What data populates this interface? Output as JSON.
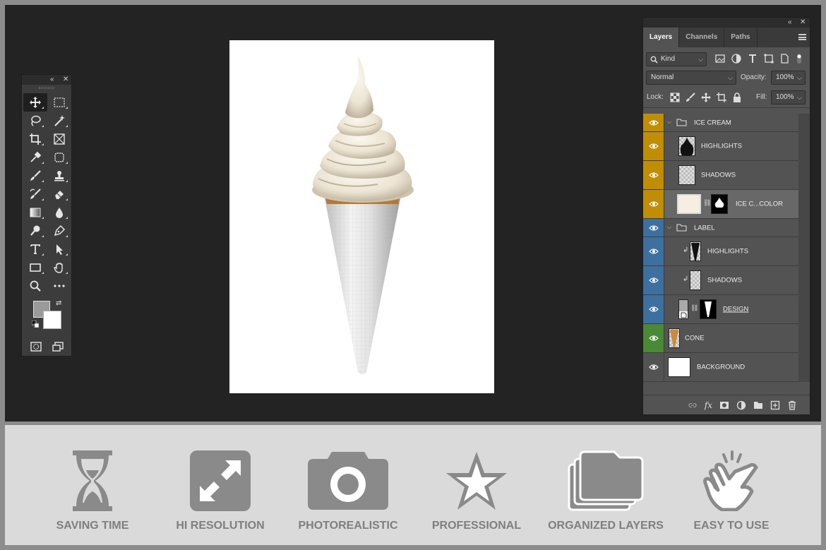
{
  "tools_panel": {
    "collapse_icon": "double-chevron-left-icon",
    "close_icon": "close-icon",
    "tools": [
      {
        "name": "move-tool",
        "icon": "move-icon",
        "active": true
      },
      {
        "name": "marquee-tool",
        "icon": "rect-marquee-icon"
      },
      {
        "name": "lasso-tool",
        "icon": "lasso-icon"
      },
      {
        "name": "magic-wand-tool",
        "icon": "magic-wand-icon"
      },
      {
        "name": "crop-tool",
        "icon": "crop-icon"
      },
      {
        "name": "frame-tool",
        "icon": "frame-icon"
      },
      {
        "name": "eyedropper-tool",
        "icon": "eyedropper-icon"
      },
      {
        "name": "spot-heal-tool",
        "icon": "patch-icon"
      },
      {
        "name": "brush-tool",
        "icon": "brush-icon"
      },
      {
        "name": "stamp-tool",
        "icon": "stamp-icon"
      },
      {
        "name": "history-brush-tool",
        "icon": "history-brush-icon"
      },
      {
        "name": "eraser-tool",
        "icon": "eraser-icon"
      },
      {
        "name": "gradient-tool",
        "icon": "gradient-icon"
      },
      {
        "name": "blur-tool",
        "icon": "drop-icon"
      },
      {
        "name": "dodge-tool",
        "icon": "dodge-icon"
      },
      {
        "name": "pen-tool",
        "icon": "pen-icon"
      },
      {
        "name": "type-tool",
        "icon": "type-icon"
      },
      {
        "name": "path-select-tool",
        "icon": "arrow-icon"
      },
      {
        "name": "shape-tool",
        "icon": "rectangle-icon"
      },
      {
        "name": "hand-tool",
        "icon": "hand-icon"
      },
      {
        "name": "zoom-tool",
        "icon": "zoom-icon"
      },
      {
        "name": "more-tool",
        "icon": "more-icon"
      }
    ],
    "foreground_color": "#9a9a9a",
    "background_color": "#ffffff"
  },
  "layers_panel": {
    "tabs": [
      "Layers",
      "Channels",
      "Paths"
    ],
    "active_tab": "Layers",
    "filter": {
      "value": "Kind"
    },
    "blend_mode": {
      "value": "Normal"
    },
    "opacity": {
      "label": "Opacity:",
      "value": "100%"
    },
    "lock": {
      "label": "Lock:"
    },
    "fill": {
      "label": "Fill:",
      "value": "100%"
    },
    "layers": [
      {
        "name": "ICE CREAM",
        "kind": "group",
        "color": "#c08e06"
      },
      {
        "name": "HIGHLIGHTS",
        "kind": "layer",
        "color": "#c08e06",
        "thumb": "highlights"
      },
      {
        "name": "SHADOWS",
        "kind": "layer",
        "color": "#c08e06",
        "thumb": "checker"
      },
      {
        "name": "ICE C...COLOR",
        "kind": "fill",
        "color": "#c08e06",
        "selected": true
      },
      {
        "name": "LABEL",
        "kind": "group",
        "color": "#3d6f9f"
      },
      {
        "name": "HIGHLIGHTS",
        "kind": "clip",
        "color": "#3d6f9f",
        "thumb": "cone-dark"
      },
      {
        "name": "SHADOWS",
        "kind": "clip",
        "color": "#3d6f9f",
        "thumb": "cone-checker"
      },
      {
        "name": "DESIGN",
        "kind": "smart",
        "color": "#3d6f9f",
        "underline": true
      },
      {
        "name": "CONE",
        "kind": "layer",
        "color": "#4a8a37",
        "thumb": "cone"
      },
      {
        "name": "BACKGROUND",
        "kind": "layer",
        "color": "",
        "thumb": "white"
      }
    ]
  },
  "features": [
    {
      "label": "SAVING TIME",
      "icon": "hourglass-icon"
    },
    {
      "label": "HI RESOLUTION",
      "icon": "expand-arrows-icon"
    },
    {
      "label": "PHOTOREALISTIC",
      "icon": "camera-icon"
    },
    {
      "label": "PROFESSIONAL",
      "icon": "star-icon"
    },
    {
      "label": "ORGANIZED LAYERS",
      "icon": "stacked-folders-icon"
    },
    {
      "label": "EASY TO USE",
      "icon": "tap-hand-icon"
    }
  ]
}
